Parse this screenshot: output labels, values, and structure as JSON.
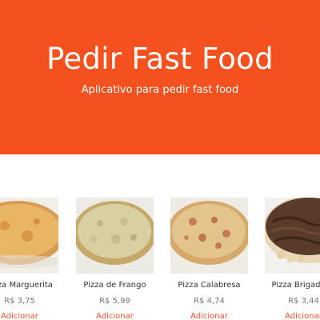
{
  "hero": {
    "title": "Pedir Fast Food",
    "subtitle": "Aplicativo para pedir fast food",
    "background_color": "#f4511e"
  },
  "products": [
    {
      "name": "Pizza Marguerita",
      "price": "R$ 3,75",
      "add_label": "Adicionar",
      "image": "pizza-marguerita-image"
    },
    {
      "name": "Pizza de Frango",
      "price": "R$ 5,99",
      "add_label": "Adicionar",
      "image": "pizza-frango-image"
    },
    {
      "name": "Pizza Calabresa",
      "price": "R$ 4,74",
      "add_label": "Adicionar",
      "image": "pizza-calabresa-image"
    },
    {
      "name": "Pizza Brigadeiro",
      "price": "R$ 3,44",
      "add_label": "Adicionar",
      "image": "pizza-brigadeiro-image"
    }
  ],
  "colors": {
    "accent": "#f4511e",
    "add_link": "#e0552a",
    "price_text": "#777777",
    "name_text": "#333333"
  }
}
